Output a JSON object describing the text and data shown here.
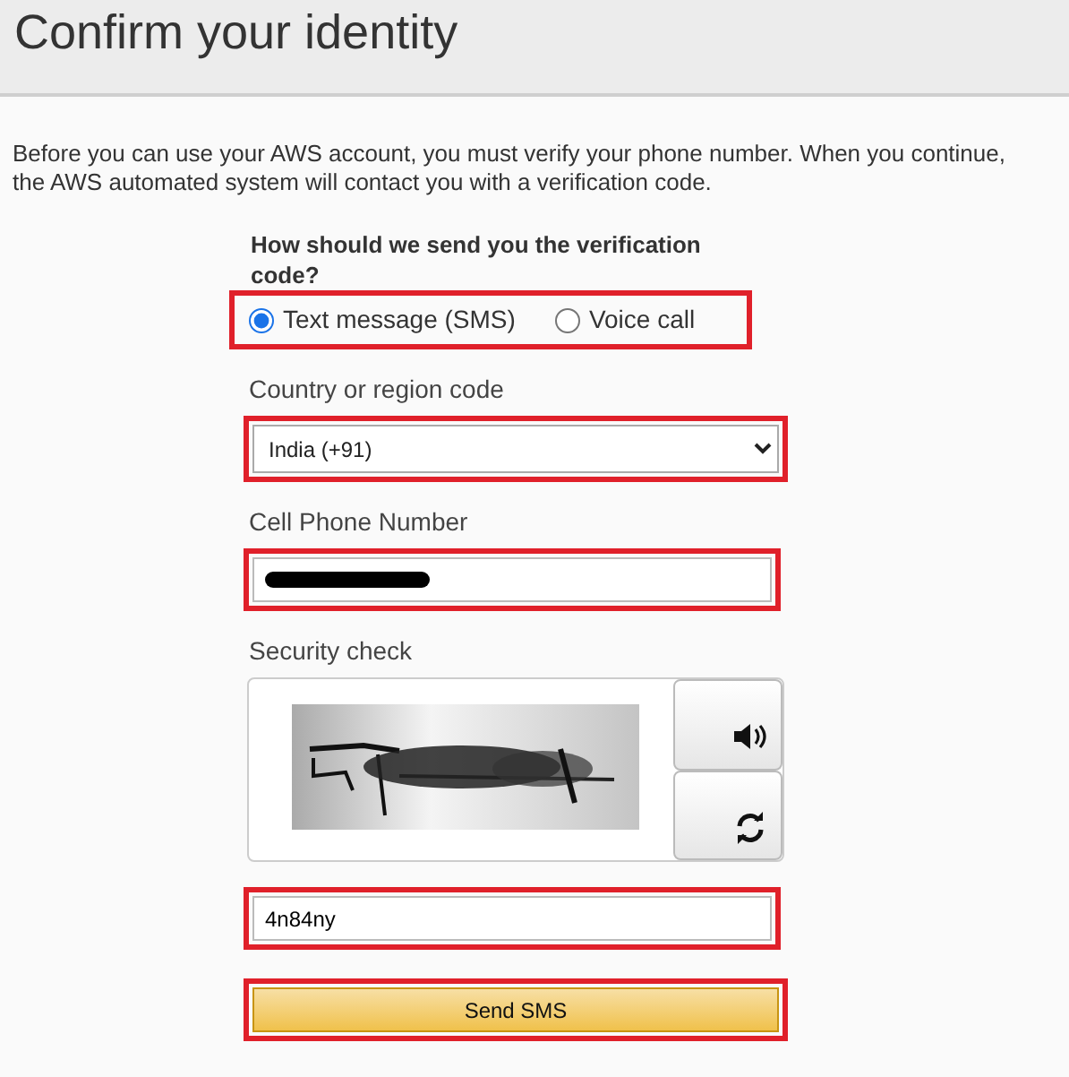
{
  "header": {
    "title": "Confirm your identity"
  },
  "intro": "Before you can use your AWS account, you must verify your phone number. When you continue, the AWS automated system will contact you with a verification code.",
  "question": "How should we send you the verification code?",
  "delivery_options": [
    {
      "label": "Text message (SMS)",
      "selected": true
    },
    {
      "label": "Voice call",
      "selected": false
    }
  ],
  "country": {
    "label": "Country or region code",
    "value": "India (+91)"
  },
  "phone": {
    "label": "Cell Phone Number",
    "redacted": true
  },
  "security": {
    "label": "Security check",
    "answer": "4n84ny"
  },
  "submit": {
    "label": "Send SMS"
  }
}
